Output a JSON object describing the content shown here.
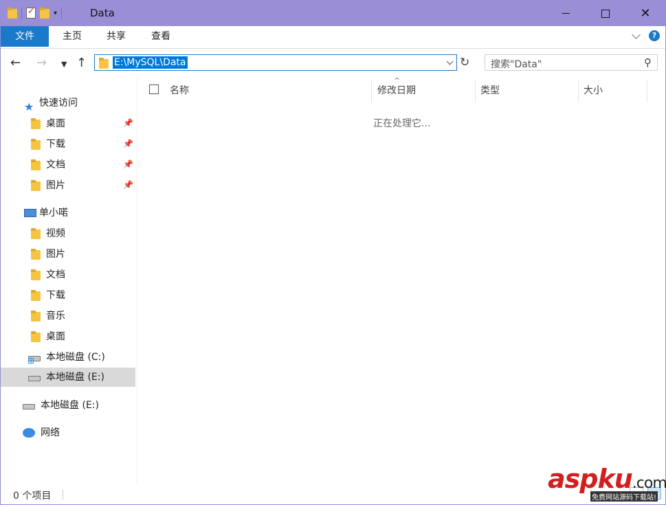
{
  "window": {
    "title": "Data"
  },
  "ribbon": {
    "tabs": [
      {
        "label": "文件"
      },
      {
        "label": "主页"
      },
      {
        "label": "共享"
      },
      {
        "label": "查看"
      }
    ]
  },
  "address": {
    "path": "E:\\MySQL\\Data"
  },
  "search": {
    "placeholder": "搜索\"Data\""
  },
  "nav": {
    "quick_access": "快速访问",
    "quick_items": [
      {
        "label": "桌面"
      },
      {
        "label": "下载"
      },
      {
        "label": "文档"
      },
      {
        "label": "图片"
      }
    ],
    "pc": "单小喏",
    "pc_items": [
      {
        "label": "视频"
      },
      {
        "label": "图片"
      },
      {
        "label": "文档"
      },
      {
        "label": "下载"
      },
      {
        "label": "音乐"
      },
      {
        "label": "桌面"
      },
      {
        "label": "本地磁盘 (C:)"
      },
      {
        "label": "本地磁盘 (E:)"
      }
    ],
    "drive": "本地磁盘 (E:)",
    "network": "网络"
  },
  "columns": {
    "name": "名称",
    "modified": "修改日期",
    "type": "类型",
    "size": "大小"
  },
  "content": {
    "status": "正在处理它..."
  },
  "statusbar": {
    "count": "0 个项目"
  },
  "watermark": {
    "brand_a": "asp",
    "brand_b": "ku",
    "brand_c": ".com",
    "tagline": "免费网站源码下载站!"
  },
  "colors": {
    "titlebar": "#9a8fd6",
    "file_tab": "#1979ca",
    "selection": "#0078d7"
  }
}
